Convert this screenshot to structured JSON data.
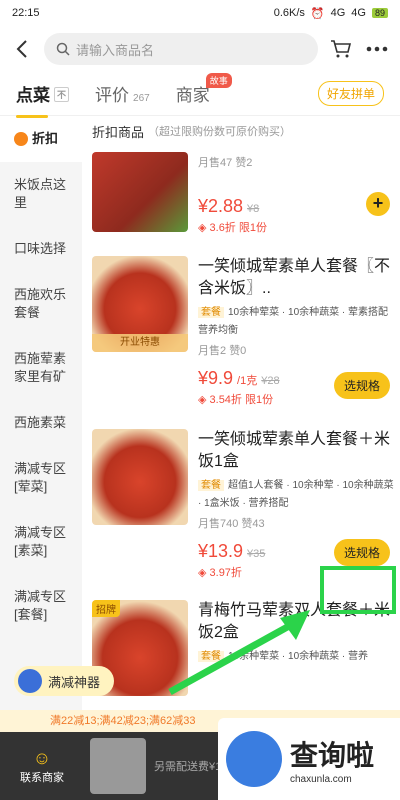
{
  "status": {
    "time": "22:15",
    "net_speed": "0.6K/s",
    "signal1": "4G",
    "signal2": "4G",
    "battery": "89"
  },
  "search": {
    "placeholder": "请输入商品名"
  },
  "tabs": [
    {
      "label": "点菜",
      "mini": "不"
    },
    {
      "label": "评价",
      "count": "267"
    },
    {
      "label": "商家",
      "badge": "故事"
    }
  ],
  "group_button": "好友拼单",
  "sidebar": {
    "active_label": "折扣",
    "items": [
      "米饭点这里",
      "口味选择",
      "西施欢乐套餐",
      "西施荤素家里有矿",
      "西施素菜",
      "满减专区[荤菜]",
      "满减专区[素菜]",
      "满减专区[套餐]"
    ]
  },
  "section": {
    "title": "折扣商品",
    "note": "（超过限购份数可原价购买）"
  },
  "items": [
    {
      "sold": "月售47",
      "likes": "赞2",
      "price": "¥2.88",
      "orig": "¥8",
      "discount": "3.6折 限1份"
    },
    {
      "name": "一笑倾城荤素单人套餐〖不含米饭〗..",
      "tag": "套餐",
      "tags_text": "10余种荤菜 · 10余种蔬菜 · 荤素搭配 营养均衡",
      "thumb_label": "开业特惠",
      "sold": "月售2",
      "likes": "赞0",
      "price": "¥9.9",
      "unit": "/1克",
      "orig": "¥28",
      "discount": "3.54折 限1份",
      "button": "选规格"
    },
    {
      "name": "一笑倾城荤素单人套餐＋米饭1盒",
      "tag": "套餐",
      "tags_text": "超值1人套餐 · 10余种荤 · 10余种蔬菜 · 1盒米饭 · 营养搭配",
      "sold": "月售740",
      "likes": "赞43",
      "price": "¥13.9",
      "orig": "¥35",
      "discount": "3.97折",
      "button": "选规格"
    },
    {
      "name": "青梅竹马荤素双人套餐＋米饭2盒",
      "tag": "套餐",
      "tags_text": "10余种荤菜 · 10余种蔬菜 · 营养",
      "thumb_tag": "招牌"
    }
  ],
  "floating": {
    "label": "满减神器"
  },
  "promo": {
    "text": "满22减13;满42减23;满62减33"
  },
  "bottom": {
    "contact": "联系商家",
    "delivery": "另需配送费¥1.5"
  },
  "watermark": {
    "title": "查询啦",
    "url": "chaxunla.com"
  }
}
